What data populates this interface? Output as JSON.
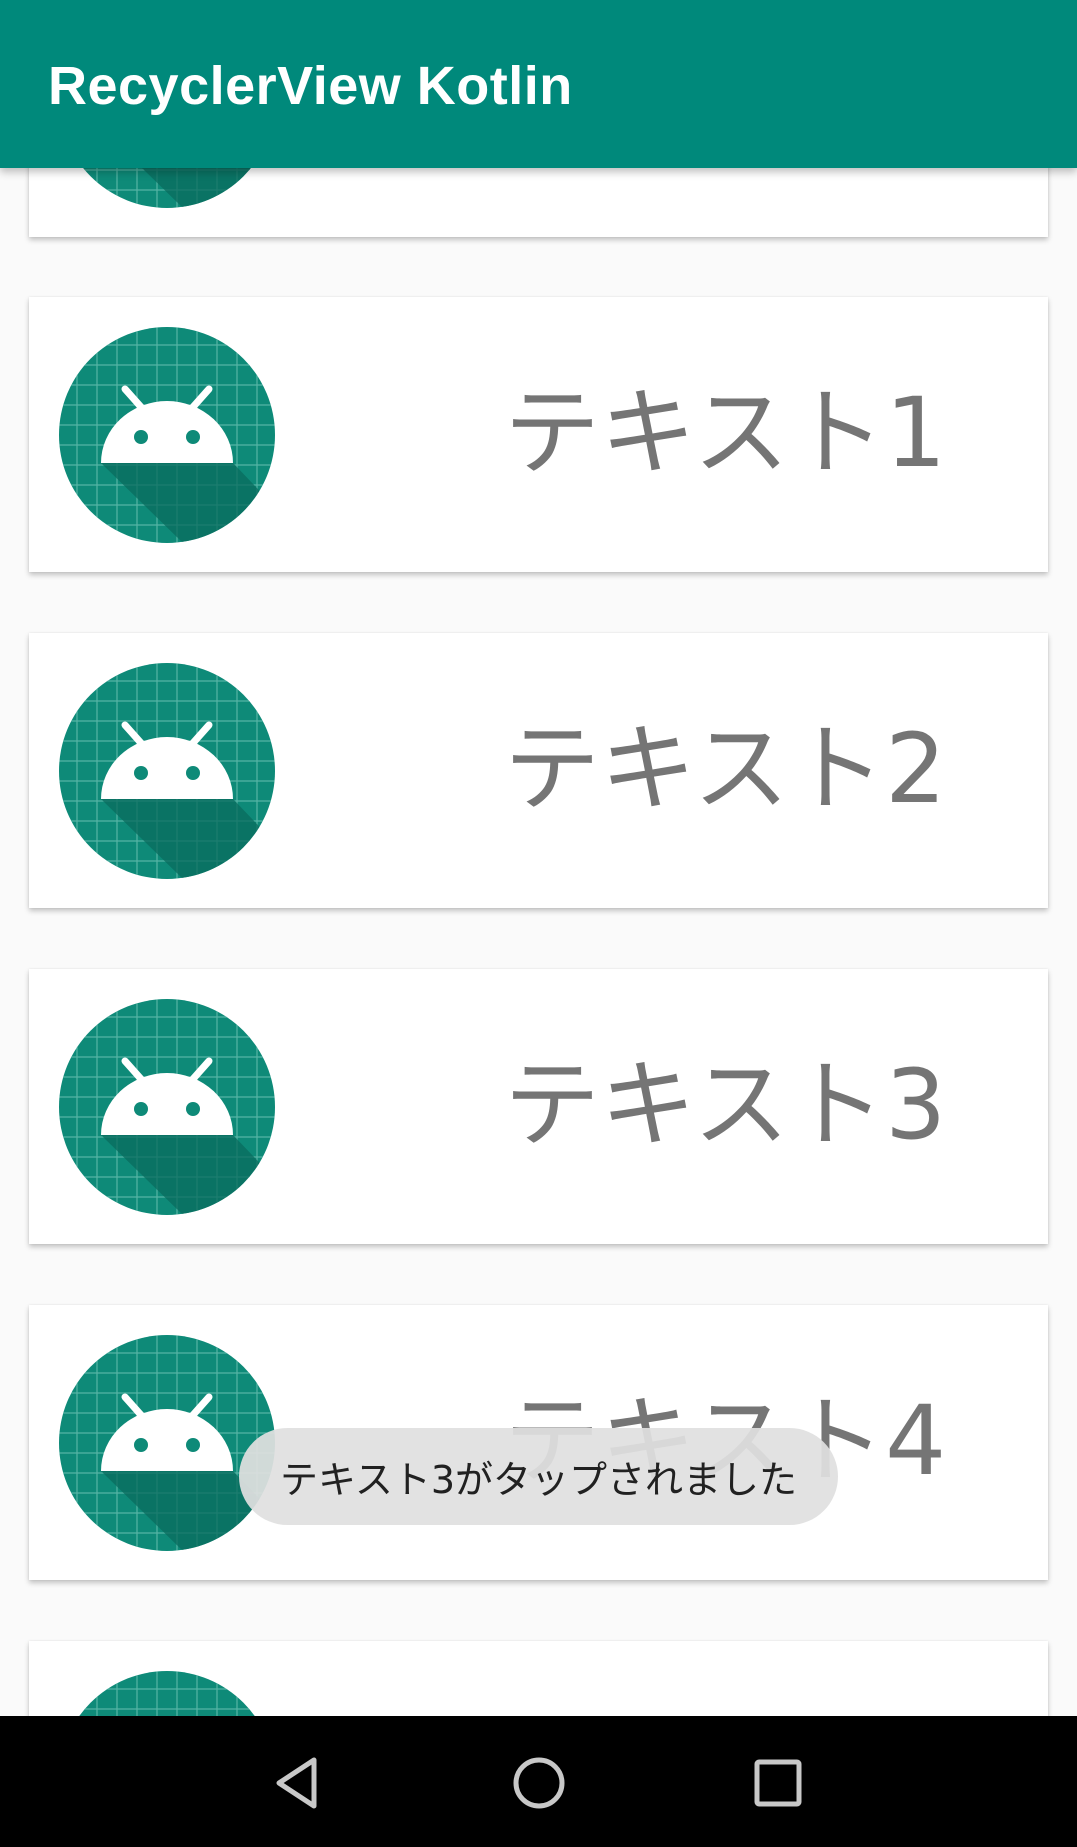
{
  "app_bar": {
    "title": "RecyclerView Kotlin",
    "background": "#00897b"
  },
  "list": {
    "items": [
      {
        "label": ""
      },
      {
        "label": "テキスト1"
      },
      {
        "label": "テキスト2"
      },
      {
        "label": "テキスト3"
      },
      {
        "label": "テキスト4"
      },
      {
        "label": ""
      }
    ],
    "item_icon": "android-launcher-icon"
  },
  "toast": {
    "message": "テキスト3がタップされました"
  },
  "nav_bar": {
    "back_icon": "triangle-back-icon",
    "home_icon": "circle-home-icon",
    "recents_icon": "square-recents-icon"
  }
}
